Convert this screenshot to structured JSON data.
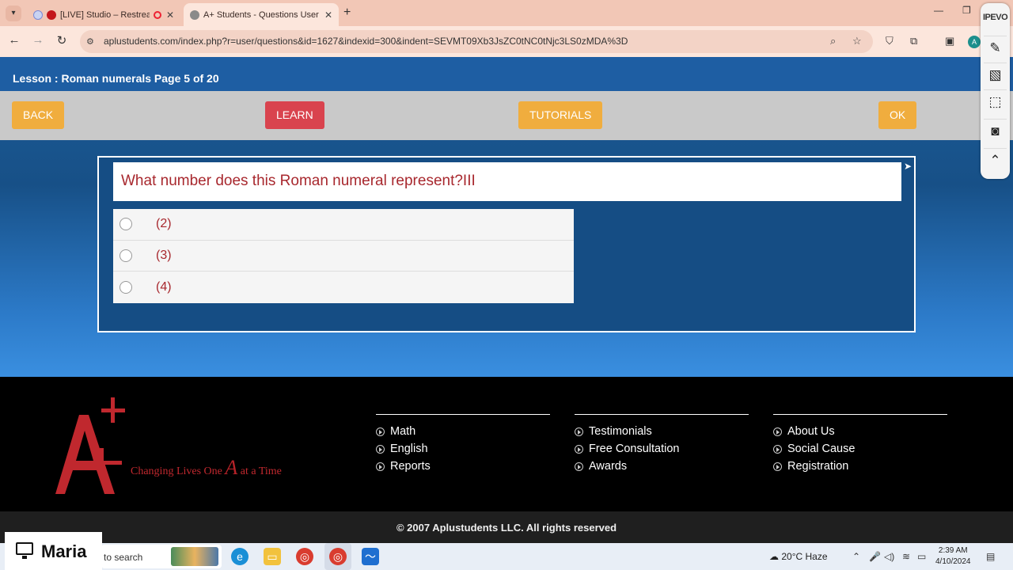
{
  "browser": {
    "tabs": [
      {
        "title": "[LIVE] Studio – Restream",
        "active": false
      },
      {
        "title": "A+ Students - Questions User",
        "active": true
      }
    ],
    "url": "aplustudents.com/index.php?r=user/questions&id=1627&indexid=300&indent=SEVMT09Xb3JsZC0tNC0tNjc3LS0zMDA%3D",
    "new_tab_label": "+"
  },
  "page": {
    "lesson_title": "Lesson : Roman numerals Page 5 of 20",
    "buttons": {
      "back": "BACK",
      "learn": "LEARN",
      "tutorials": "TUTORIALS",
      "ok": "OK"
    },
    "question": "What number does this Roman numeral represent?III",
    "options": [
      "(2)",
      "(3)",
      "(4)"
    ]
  },
  "footer": {
    "tagline_prefix": "Changing Lives One",
    "tagline_letter": "A",
    "tagline_suffix": "at a Time",
    "columns": [
      [
        "Math",
        "English",
        "Reports"
      ],
      [
        "Testimonials",
        "Free Consultation",
        "Awards"
      ],
      [
        "About Us",
        "Social Cause",
        "Registration"
      ]
    ],
    "copyright": "© 2007 Aplustudents LLC. All rights reserved"
  },
  "ipevo": {
    "logo": "IPEVO"
  },
  "taskbar": {
    "search_placeholder": "to search",
    "weather_temp": "20°C",
    "weather_desc": "Haze",
    "time": "2:39 AM",
    "date": "4/10/2024"
  },
  "overlay": {
    "name": "Maria"
  },
  "colors": {
    "accent_orange": "#f0ad3e",
    "learn_red": "#d9434e",
    "question_text": "#a8282e",
    "page_blue": "#1e5ea3"
  }
}
